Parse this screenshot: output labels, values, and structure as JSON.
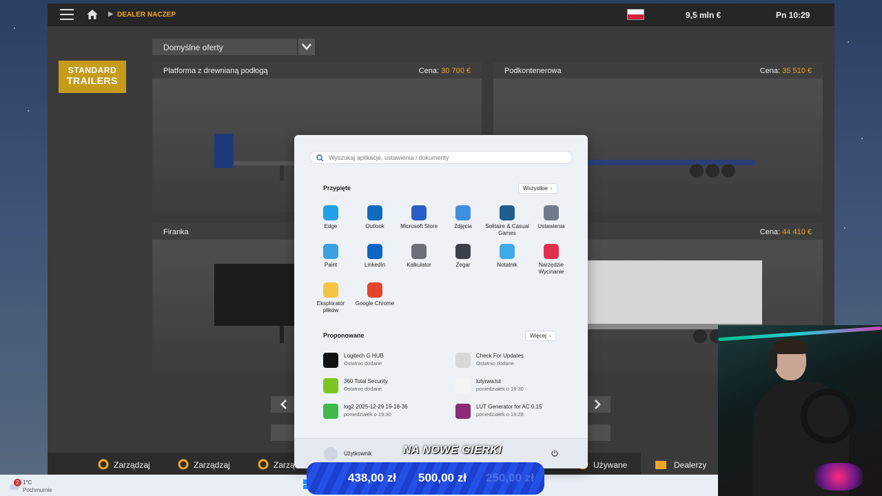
{
  "game": {
    "breadcrumb": "DEALER NACZEP",
    "money": "9,5 mln  €",
    "clock": "Pn 10:29",
    "filter_value": "Domyślne oferty",
    "brand": {
      "line1": "STANDARD",
      "line2": "TRAILERS"
    },
    "price_label": "Cena:",
    "offers": [
      {
        "name": "Platforma z drewnianą podłogą",
        "price": "30 700 €"
      },
      {
        "name": "Podkontenerowa",
        "price": "35 510 €"
      },
      {
        "name": "Firanka",
        "price": ""
      },
      {
        "name": "",
        "price": "44 410 €"
      }
    ],
    "bottom_bar": [
      "Zarządzaj",
      "Zarządzaj",
      "Zarządzaj",
      "Używane",
      "Dealerzy"
    ]
  },
  "start_menu": {
    "search_placeholder": "Wyszukaj aplikacje, ustawienia i dokumenty",
    "pinned_title": "Przypięte",
    "all_button": "Wszystkie",
    "pinned": [
      {
        "label": "Edge",
        "icon": "edge-icon",
        "color": "#1fa0e8"
      },
      {
        "label": "Outlook",
        "icon": "outlook-icon",
        "color": "#0f6cbd"
      },
      {
        "label": "Microsoft Store",
        "icon": "store-icon",
        "color": "#2b5cc7"
      },
      {
        "label": "Zdjęcia",
        "icon": "photos-icon",
        "color": "#3f8fe0"
      },
      {
        "label": "Solitaire & Casual Games",
        "icon": "solitaire-icon",
        "color": "#1f5f8f"
      },
      {
        "label": "Ustawienia",
        "icon": "settings-icon",
        "color": "#6f7a8a"
      },
      {
        "label": "Paint",
        "icon": "paint-icon",
        "color": "#3aa0e0"
      },
      {
        "label": "LinkedIn",
        "icon": "linkedin-icon",
        "color": "#0a66c2"
      },
      {
        "label": "Kalkulator",
        "icon": "calculator-icon",
        "color": "#6a6f78"
      },
      {
        "label": "Zegar",
        "icon": "clock-icon",
        "color": "#3a3f48"
      },
      {
        "label": "Notatnik",
        "icon": "notepad-icon",
        "color": "#3da9e8"
      },
      {
        "label": "Narzędzie Wycinanie",
        "icon": "snipping-tool-icon",
        "color": "#e0304d"
      },
      {
        "label": "Eksplorator plików",
        "icon": "file-explorer-icon",
        "color": "#f5c342"
      },
      {
        "label": "Google Chrome",
        "icon": "chrome-icon",
        "color": "#e2452b"
      }
    ],
    "recommended_title": "Proponowane",
    "more_button": "Więcej",
    "recommended": [
      {
        "name": "Logitech G HUB",
        "sub": "Ostatnio dodane",
        "icon": "logitech-icon",
        "color": "#111111"
      },
      {
        "name": "Check For Updates",
        "sub": "Ostatnio dodane",
        "icon": "java-icon",
        "color": "#d8d8d8"
      },
      {
        "name": "360 Total Security",
        "sub": "Ostatnio dodane",
        "icon": "security-icon",
        "color": "#7cc520"
      },
      {
        "name": "lutyrwa.lut",
        "sub": "poniedziałek o 19:30",
        "icon": "file-icon",
        "color": "#f4f4f4"
      },
      {
        "name": "log2 2025-12-29 19-18-36",
        "sub": "poniedziałek o 19:30",
        "icon": "spreadsheet-icon",
        "color": "#41b84a"
      },
      {
        "name": "LUT Generator for AC 0.15",
        "sub": "poniedziałek o 19:28",
        "icon": "winrar-icon",
        "color": "#8b2b7a"
      }
    ],
    "user": "Użytkownik"
  },
  "taskbar": {
    "weather_badge": "2",
    "temperature": "1°C",
    "condition": "Pochmurnie"
  },
  "overlay": {
    "title": "NA NOWE GIERKI",
    "amounts": [
      "438,00 zł",
      "500,00 zł",
      "250,00 zł"
    ]
  }
}
